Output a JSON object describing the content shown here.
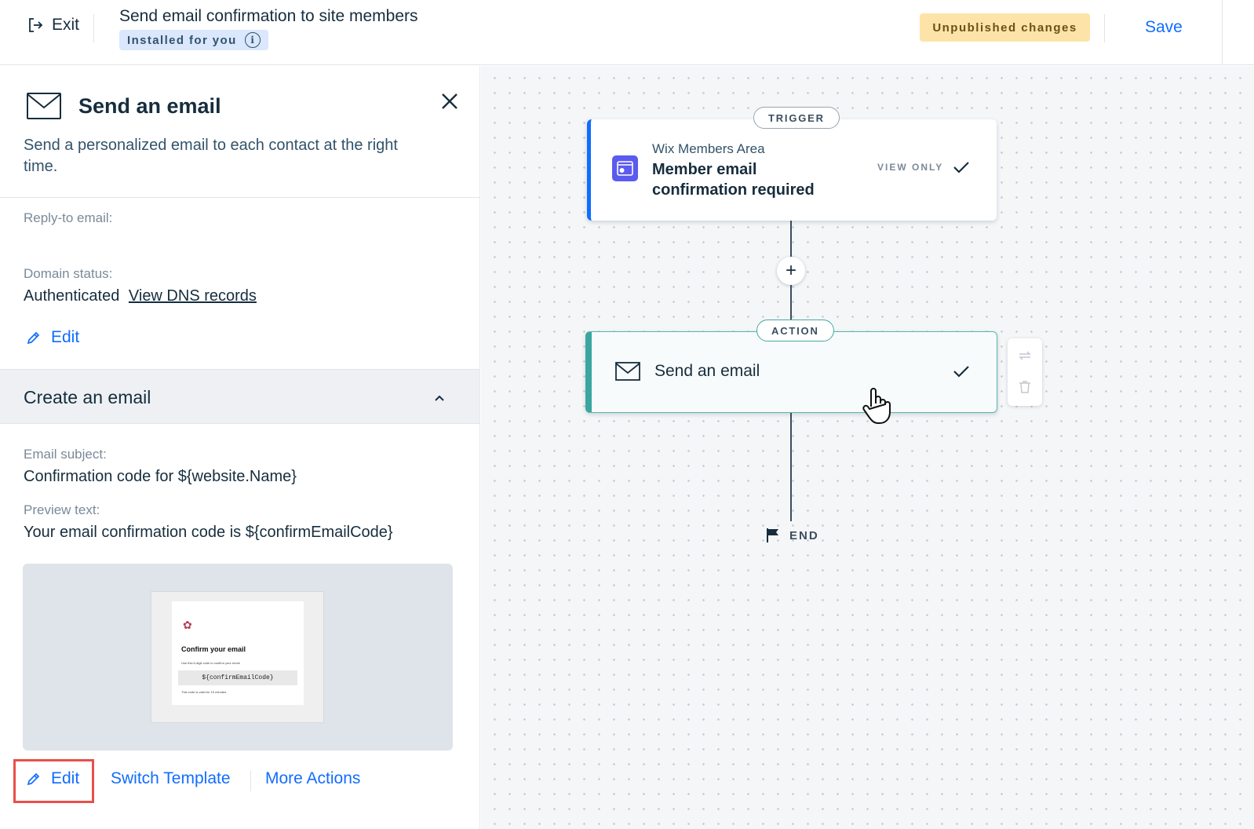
{
  "topbar": {
    "exit_label": "Exit",
    "title": "Send email confirmation to site members",
    "installed_badge": "Installed for you",
    "unpublished_badge": "Unpublished changes",
    "save_label": "Save"
  },
  "panel": {
    "title": "Send an email",
    "description": "Send a personalized email to each contact at the right time.",
    "reply_to_label": "Reply-to email:",
    "reply_to_value": "",
    "domain_status_label": "Domain status:",
    "domain_status_value": "Authenticated",
    "view_dns_link": "View DNS records",
    "sender_edit_label": "Edit",
    "section_title": "Create an email",
    "email_subject_label": "Email subject:",
    "email_subject_value": "Confirmation code for ${website.Name}",
    "preview_text_label": "Preview text:",
    "preview_text_value": "Your email confirmation code is ${confirmEmailCode}",
    "email_preview": {
      "heading": "Confirm your email",
      "body": "Use this 6-digit code to confirm your email",
      "code": "${confirmEmailCode}",
      "footer": "This code is valid for 15 minutes."
    },
    "actions": {
      "edit": "Edit",
      "switch_template": "Switch Template",
      "more_actions": "More Actions"
    }
  },
  "canvas": {
    "trigger": {
      "tag": "TRIGGER",
      "app_name": "Wix Members Area",
      "name": "Member email confirmation required",
      "view_only": "VIEW ONLY"
    },
    "action": {
      "tag": "ACTION",
      "title": "Send an email"
    },
    "add_step_symbol": "+",
    "end_label": "END"
  },
  "colors": {
    "accent": "#116dff",
    "trigger_border": "#116dff",
    "action_border": "#3aa6a0",
    "unpublished_bg": "#fde3a7",
    "installed_bg": "#dae7fd",
    "highlight": "#e8504b"
  }
}
